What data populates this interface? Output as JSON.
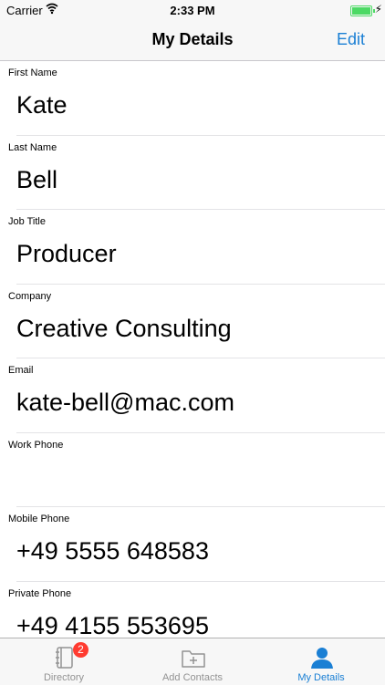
{
  "status_bar": {
    "carrier": "Carrier",
    "time": "2:33 PM",
    "battery_level": 1.0,
    "accent_color": "#4cd964"
  },
  "nav": {
    "title": "My Details",
    "edit_label": "Edit",
    "accent_color": "#1a7fd4"
  },
  "fields": [
    {
      "label": "First Name",
      "value": "Kate"
    },
    {
      "label": "Last Name",
      "value": "Bell"
    },
    {
      "label": "Job Title",
      "value": "Producer"
    },
    {
      "label": "Company",
      "value": "Creative Consulting"
    },
    {
      "label": "Email",
      "value": "kate-bell@mac.com"
    },
    {
      "label": "Work Phone",
      "value": ""
    },
    {
      "label": "Mobile Phone",
      "value": "+49 5555 648583"
    },
    {
      "label": "Private Phone",
      "value": "+49 4155 553695"
    }
  ],
  "tabs": [
    {
      "label": "Directory",
      "icon": "notebook-icon",
      "badge": "2"
    },
    {
      "label": "Add Contacts",
      "icon": "add-folder-icon"
    },
    {
      "label": "My Details",
      "icon": "person-icon",
      "active": true
    }
  ]
}
